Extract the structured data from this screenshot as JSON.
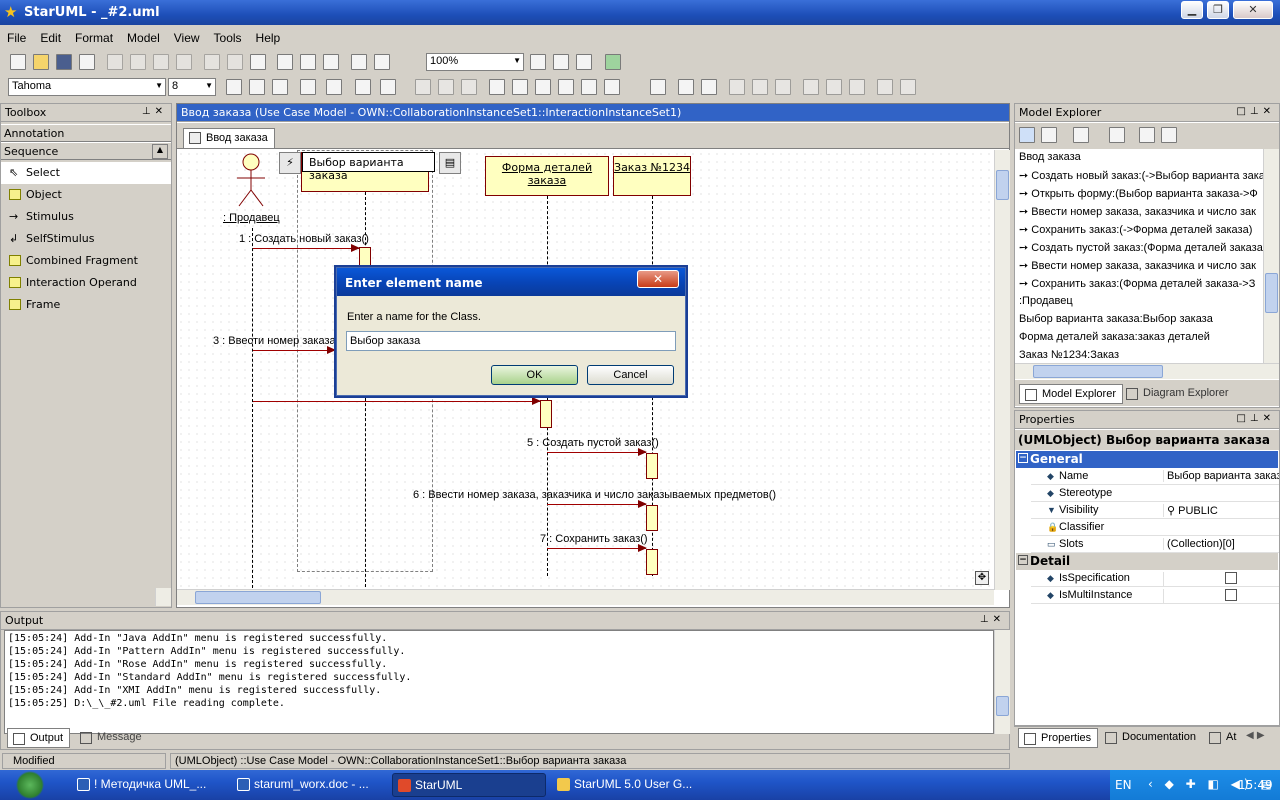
{
  "window": {
    "title": "StarUML - _#2.uml"
  },
  "menu": [
    "File",
    "Edit",
    "Format",
    "Model",
    "View",
    "Tools",
    "Help"
  ],
  "toolbar": {
    "zoom": "100%",
    "font": "Tahoma",
    "font_size": "8"
  },
  "toolbox": {
    "title": "Toolbox",
    "sections": [
      "Annotation",
      "Sequence"
    ],
    "items": [
      "Select",
      "Object",
      "Stimulus",
      "SelfStimulus",
      "Combined Fragment",
      "Interaction Operand",
      "Frame"
    ]
  },
  "diagram": {
    "title": "Ввод заказа (Use Case Model - OWN::CollaborationInstanceSet1::InteractionInstanceSet1)",
    "tab": "Ввод заказа",
    "actor": ": Продавец",
    "objects": [
      "Выбор варианта заказа",
      "Форма деталей заказа",
      "Заказ №1234"
    ],
    "messages": [
      "1 : Создать новый заказ()",
      "3 : Ввести номер заказа",
      "5 : Создать пустой заказ()",
      "6 : Ввести номер заказа, заказчика и число заказываемых предметов()",
      "7 : Сохранить заказ()"
    ]
  },
  "dialog": {
    "title": "Enter element name",
    "prompt": "Enter a name for the Class.",
    "value": "Выбор заказа",
    "ok": "OK",
    "cancel": "Cancel"
  },
  "explorer": {
    "title": "Model Explorer",
    "items": [
      "Ввод заказа",
      "Создать новый заказ:(->Выбор варианта заказа",
      "Открыть форму:(Выбор варианта заказа->Ф",
      "Ввести номер заказа, заказчика и число зак",
      "Сохранить заказ:(->Форма деталей заказа)",
      "Создать пустой заказ:(Форма деталей заказа",
      "Ввести номер заказа, заказчика и число зак",
      "Сохранить заказ:(Форма деталей заказа->З",
      ":Продавец",
      "Выбор варианта заказа:Выбор заказа",
      "Форма деталей заказа:заказ деталей",
      "Заказ №1234:Заказ"
    ],
    "tabs": [
      "Model Explorer",
      "Diagram Explorer"
    ]
  },
  "properties": {
    "title": "Properties",
    "header": "(UMLObject) Выбор варианта заказа",
    "general": "General",
    "detail": "Detail",
    "rows": [
      {
        "k": "Name",
        "v": "Выбор варианта заказа"
      },
      {
        "k": "Stereotype",
        "v": ""
      },
      {
        "k": "Visibility",
        "v": "PUBLIC"
      },
      {
        "k": "Classifier",
        "v": ""
      },
      {
        "k": "Slots",
        "v": "(Collection)[0]"
      }
    ],
    "detail_rows": [
      "IsSpecification",
      "IsMultiInstance"
    ],
    "tabs": [
      "Properties",
      "Documentation",
      "At"
    ]
  },
  "output": {
    "title": "Output",
    "lines": [
      "[15:05:24]  Add-In \"Java AddIn\" menu is registered successfully.",
      "[15:05:24]  Add-In \"Pattern AddIn\" menu is registered successfully.",
      "[15:05:24]  Add-In \"Rose AddIn\" menu is registered successfully.",
      "[15:05:24]  Add-In \"Standard AddIn\" menu is registered successfully.",
      "[15:05:24]  Add-In \"XMI AddIn\" menu is registered successfully.",
      "[15:05:25]  D:\\_\\_#2.uml File reading complete."
    ],
    "tabs": [
      "Output",
      "Message"
    ]
  },
  "status": {
    "state": "Modified",
    "path": "(UMLObject) ::Use Case Model - OWN::CollaborationInstanceSet1::Выбор варианта заказа"
  },
  "taskbar": {
    "tasks": [
      "! Методичка UML_...",
      "staruml_worx.doc - ...",
      "StarUML",
      "StarUML 5.0 User G..."
    ],
    "lang": "EN",
    "clock": "15:49"
  }
}
